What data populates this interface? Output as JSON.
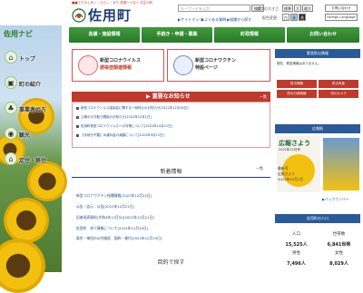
{
  "header": {
    "tagline": "■■でたのしめく・ひらく・まち 笑顔へつなぐ 共生の町",
    "title": "佐用町",
    "search_placeholder": "キーワードを入力",
    "search_button": "検索",
    "font_size_label": "文字の大きさ",
    "size_standard": "標準",
    "size_large": "大",
    "size_xlarge": "最大",
    "bg_color_label": "配色変更",
    "bg_white": "白",
    "bg_blue": "青",
    "bg_black": "黒",
    "links": [
      "サイトマップ",
      "よくある質問",
      "組織から探す",
      "お問い合わせ",
      "Foreign Language"
    ]
  },
  "side": {
    "title": "佐用ナビ",
    "items": [
      {
        "label": "トップ",
        "icon": "house-icon"
      },
      {
        "label": "町の紹介",
        "icon": "town-icon"
      },
      {
        "label": "事業者の方",
        "icon": "business-icon"
      },
      {
        "label": "観光",
        "icon": "camera-icon"
      },
      {
        "label": "定住・移住",
        "icon": "house2-icon"
      }
    ]
  },
  "nav": [
    "各課・施設情報",
    "手続き・申請・募集",
    "町政情報",
    "お問い合わせ"
  ],
  "banners": [
    {
      "line1": "新型コロナウイルス",
      "line2": "感染症関連情報"
    },
    {
      "line1": "新型コロナワクチン",
      "line2": "特設ページ"
    }
  ],
  "news": {
    "title": "重要なお知らせ",
    "list_label": "一覧",
    "items": [
      "新型コロナウイルス感染症に関する一時停止のお知らせ[2022年12月16日]",
      "上峰の引き取り開始のお知らせ[2022年12月1日]",
      "佐用町新型コロナウイルスへの対策について[2022年10月21日]",
      "【手続き不要】水道料金の減額について[2022年9月12日]"
    ]
  },
  "updates": {
    "title": "新着情報",
    "list_label": "一覧",
    "items": [
      "新型コロナワクチン接種情報[2022年12月22日]",
      "公告・告示 - 公告[2022年12月21日]",
      "記者発表資料(令和4年12月分)[2022年12月21日]",
      "佐用町　求人情報について[2022年12月19日]",
      "東京・神田の公共施設　国府・貸付[2022年12月19日]"
    ]
  },
  "search_section": {
    "title": "目的で探す"
  },
  "right": {
    "emergency_title": "緊急防災情報",
    "emergency_text": "現在、緊急情報はありません。",
    "buttons": [
      "防災情報",
      "防災気象",
      "防災行政無線",
      "河川カメラ"
    ],
    "koho_title": "広報紙",
    "koho_name": "広報さよう",
    "koho_date": "2022年12月号",
    "koho_line1": "最新号",
    "koho_line2": "広報さよう",
    "koho_issue": "2022年12月1日",
    "back_number": "バックナンバー",
    "pop_title": "佐用町の人口",
    "pop_labels": [
      "人口",
      "世帯数",
      "男性",
      "女性"
    ],
    "pop_values": [
      "15,525人",
      "6,841世帯",
      "7,496人",
      "8,029人"
    ]
  },
  "colors": {
    "green": "#2f8a2f",
    "navy": "#1f3d7a",
    "red": "#c0392b",
    "blue": "#2a5a9a"
  }
}
